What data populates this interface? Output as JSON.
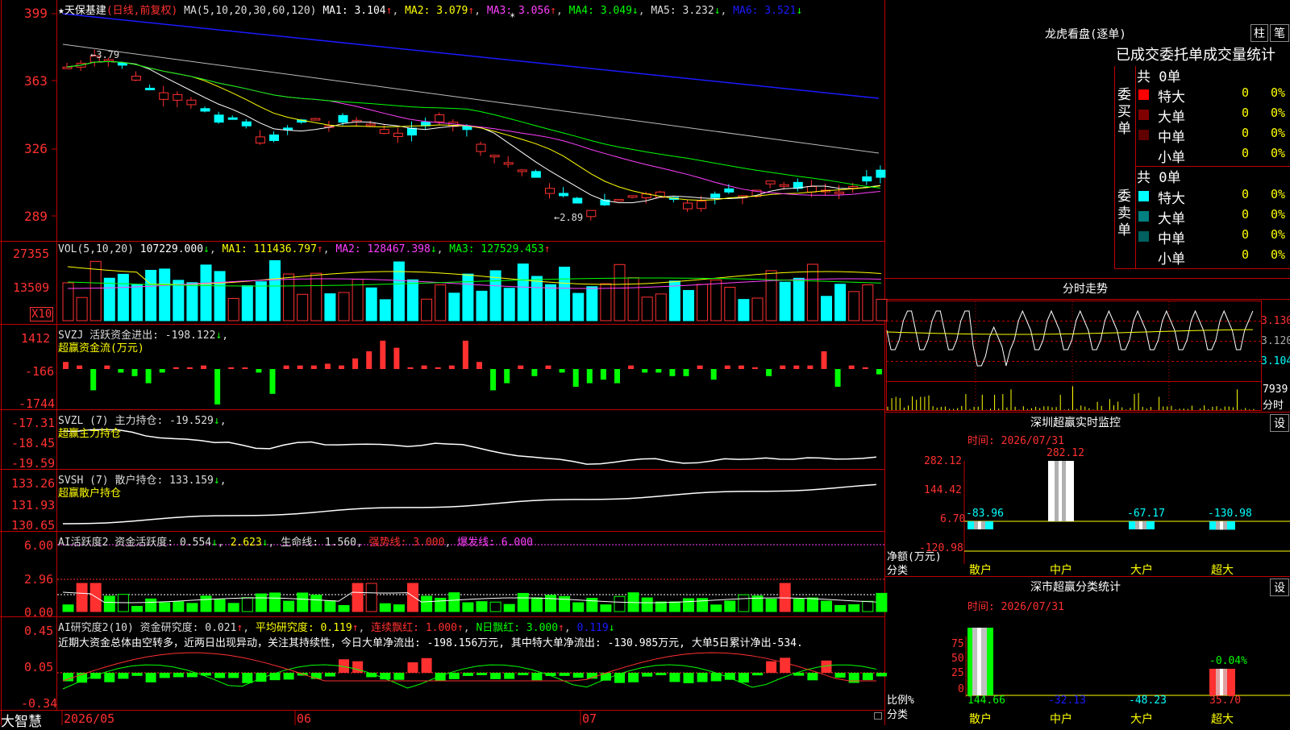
{
  "colors": {
    "red": "#ff3030",
    "cyan": "#00ffff",
    "yellow": "#ffff00",
    "magenta": "#ff40ff",
    "green": "#00ff00",
    "blue": "#1a1aff",
    "grid": "#c00000",
    "white": "#ffffff"
  },
  "main": {
    "title": "★天保基建",
    "mode": "(日线,前复权)",
    "ma_label": "MA(5,10,20,30,60,120)",
    "ma": [
      "MA1: 3.104",
      "MA2: 3.079",
      "MA3: 3.056",
      "MA4: 3.049",
      "MA5: 3.232",
      "MA6: 3.521"
    ],
    "y_ticks": [
      "399",
      "363",
      "326",
      "289"
    ],
    "high_mark": "3.79",
    "low_mark": "2.89",
    "star": "*"
  },
  "vol": {
    "label": "VOL(5,10,20)",
    "v": "107229.000",
    "ma1": "MA1: 111436.797",
    "ma2": "MA2: 128467.398",
    "ma3": "MA3: 127529.453",
    "y_ticks": [
      "27355",
      "13509"
    ],
    "unit": "X10"
  },
  "svzj": {
    "label": "SVZJ  活跃资金进出: -198.122",
    "sub": "超赢资金流(万元)",
    "y_ticks": [
      "1412",
      "-166",
      "-1744"
    ]
  },
  "svzl": {
    "label": "SVZL (7) 主力持仓: -19.529",
    "sub": "超赢主力持仓",
    "y_ticks": [
      "-17.31",
      "-18.45",
      "-19.59"
    ]
  },
  "svsh": {
    "label": "SVSH (7) 散户持仓: 133.159",
    "sub": "超赢散户持仓",
    "y_ticks": [
      "133.26",
      "131.93",
      "130.65"
    ]
  },
  "ai1": {
    "label": "AI活跃度2 资金活跃度: 0.554",
    "v2": "2.623",
    "life": "生命线: 1.560",
    "strong": "强势线: 3.000",
    "burst": "爆发线: 6.000",
    "y_ticks": [
      "6.00",
      "2.96",
      "0.00"
    ]
  },
  "ai2": {
    "label": "AI研究度2(10) 资金研究度: 0.021",
    "avg": "平均研究度: 0.119",
    "cont": "连续飘红: 1.000",
    "nday": "N日飘红: 3.000",
    "last": "0.119",
    "comment": "近期大资金总体由空转多，近两日出现异动，关注其持续性，今日大单净流出: -198.156万元, 其中特大单净流出: -130.985万元, 大单5日累计净出-534.",
    "y_ticks": [
      "0.45",
      "0.05",
      "-0.34"
    ]
  },
  "xaxis": {
    "labels": [
      "2026/05",
      "06",
      "07"
    ],
    "brand": "大智慧"
  },
  "dragon": {
    "title": "龙虎看盘(逐单)",
    "btn1": "柱",
    "btn2": "笔",
    "header": "已成交委托单成交量统计",
    "buy": {
      "side": "委买单",
      "total": "共 0单",
      "rows": [
        {
          "name": "特大",
          "v": "0",
          "p": "0%"
        },
        {
          "name": "大单",
          "v": "0",
          "p": "0%"
        },
        {
          "name": "中单",
          "v": "0",
          "p": "0%"
        },
        {
          "name": "小单",
          "v": "0",
          "p": "0%"
        }
      ]
    },
    "sell": {
      "side": "委卖单",
      "total": "共 0单",
      "rows": [
        {
          "name": "特大",
          "v": "0",
          "p": "0%"
        },
        {
          "name": "大单",
          "v": "0",
          "p": "0%"
        },
        {
          "name": "中单",
          "v": "0",
          "p": "0%"
        },
        {
          "name": "小单",
          "v": "0",
          "p": "0%"
        }
      ]
    }
  },
  "intraday": {
    "title": "分时走势",
    "y_ticks": [
      "3.130",
      "3.120",
      "3.104"
    ],
    "vol": "7939",
    "unit": "分时"
  },
  "sz_monitor": {
    "title": "深圳超赢实时监控",
    "set": "设",
    "time": "时间: 2026/07/31",
    "y_ticks": [
      "282.12",
      "144.42",
      "6.70",
      "-120.98"
    ],
    "ylabel": "净额(万元)",
    "xlabel": "分类",
    "cats": [
      "散户",
      "中户",
      "大户",
      "超大"
    ],
    "values": [
      "-83.96",
      "282.12",
      "-67.17",
      "-130.98"
    ]
  },
  "sz_class": {
    "title": "深市超赢分类统计",
    "set": "设",
    "time": "时间: 2026/07/31",
    "y_ticks": [
      "75",
      "50",
      "25",
      "0"
    ],
    "ylabel": "比例%",
    "xlabel": "分类",
    "cats": [
      "散户",
      "中户",
      "大户",
      "超大"
    ],
    "values": [
      "144.66",
      "-32.13",
      "-48.23",
      "35.70"
    ],
    "pct": "-0.04%"
  }
}
